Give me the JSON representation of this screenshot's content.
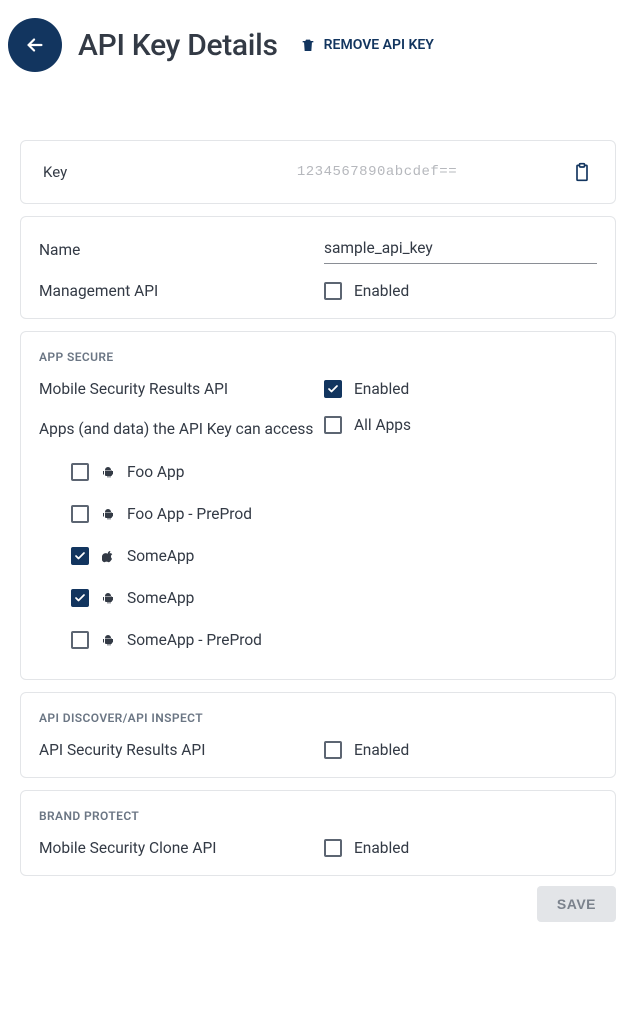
{
  "header": {
    "title": "API Key Details",
    "remove_label": "REMOVE API KEY"
  },
  "key_card": {
    "label": "Key",
    "value": "1234567890abcdef=="
  },
  "name_row": {
    "label": "Name",
    "value": "sample_api_key"
  },
  "mgmt_row": {
    "label": "Management API",
    "checkbox_label": "Enabled",
    "checked": false
  },
  "app_secure": {
    "heading": "APP SECURE",
    "results_label": "Mobile Security Results API",
    "results_checkbox_label": "Enabled",
    "results_checked": true,
    "access_label": "Apps (and data) the API Key can access",
    "all_apps_label": "All Apps",
    "all_apps_checked": false,
    "apps": [
      {
        "name": "Foo App",
        "platform": "android",
        "checked": false
      },
      {
        "name": "Foo App - PreProd",
        "platform": "android",
        "checked": false
      },
      {
        "name": "SomeApp",
        "platform": "apple",
        "checked": true
      },
      {
        "name": "SomeApp",
        "platform": "android",
        "checked": true
      },
      {
        "name": "SomeApp - PreProd",
        "platform": "android",
        "checked": false
      }
    ]
  },
  "api_discover": {
    "heading": "API DISCOVER/API INSPECT",
    "label": "API Security Results API",
    "checkbox_label": "Enabled",
    "checked": false
  },
  "brand_protect": {
    "heading": "BRAND PROTECT",
    "label": "Mobile Security Clone API",
    "checkbox_label": "Enabled",
    "checked": false
  },
  "save_label": "SAVE"
}
